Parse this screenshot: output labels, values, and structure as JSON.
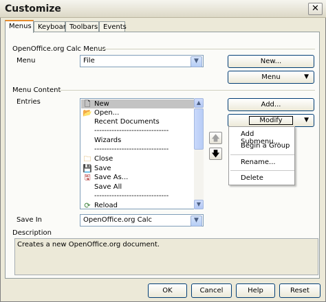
{
  "window": {
    "title": "Customize",
    "close_glyph": "✕"
  },
  "tabs": [
    {
      "label": "Menus",
      "active": true
    },
    {
      "label": "Keyboard",
      "active": false
    },
    {
      "label": "Toolbars",
      "active": false
    },
    {
      "label": "Events",
      "active": false
    }
  ],
  "menus_section": {
    "title": "OpenOffice.org Calc Menus",
    "menu_label": "Menu",
    "menu_value": "File",
    "new_button": "New...",
    "menu_button": "Menu"
  },
  "content_section": {
    "title": "Menu Content",
    "entries_label": "Entries",
    "add_button": "Add...",
    "modify_button": "Modify",
    "entries": [
      {
        "label": "New",
        "icon": "new-document-icon",
        "selected": true
      },
      {
        "label": "Open...",
        "icon": "open-folder-icon"
      },
      {
        "label": "Recent Documents",
        "icon": ""
      },
      {
        "label": "------------------------------",
        "icon": ""
      },
      {
        "label": "Wizards",
        "icon": ""
      },
      {
        "label": "------------------------------",
        "icon": ""
      },
      {
        "label": "Close",
        "icon": "close-document-icon"
      },
      {
        "label": "Save",
        "icon": "save-icon"
      },
      {
        "label": "Save As...",
        "icon": "save-as-icon"
      },
      {
        "label": "Save All",
        "icon": ""
      },
      {
        "label": "------------------------------",
        "icon": ""
      },
      {
        "label": "Reload",
        "icon": "reload-icon"
      }
    ],
    "save_in_label": "Save In",
    "save_in_value": "OpenOffice.org Calc"
  },
  "modify_menu": {
    "items": [
      "Add Submenu...",
      "Begin a Group",
      "Rename...",
      "Delete"
    ]
  },
  "description": {
    "label": "Description",
    "text": "Creates a new OpenOffice.org document."
  },
  "footer": {
    "ok": "OK",
    "cancel": "Cancel",
    "help": "Help",
    "reset": "Reset"
  },
  "glyphs": {
    "combo_arrow": "▼",
    "up_arrow": "▲",
    "down_arrow": "▼",
    "dropdown": "▼",
    "move_up": "🡅",
    "move_down": "🡇"
  }
}
